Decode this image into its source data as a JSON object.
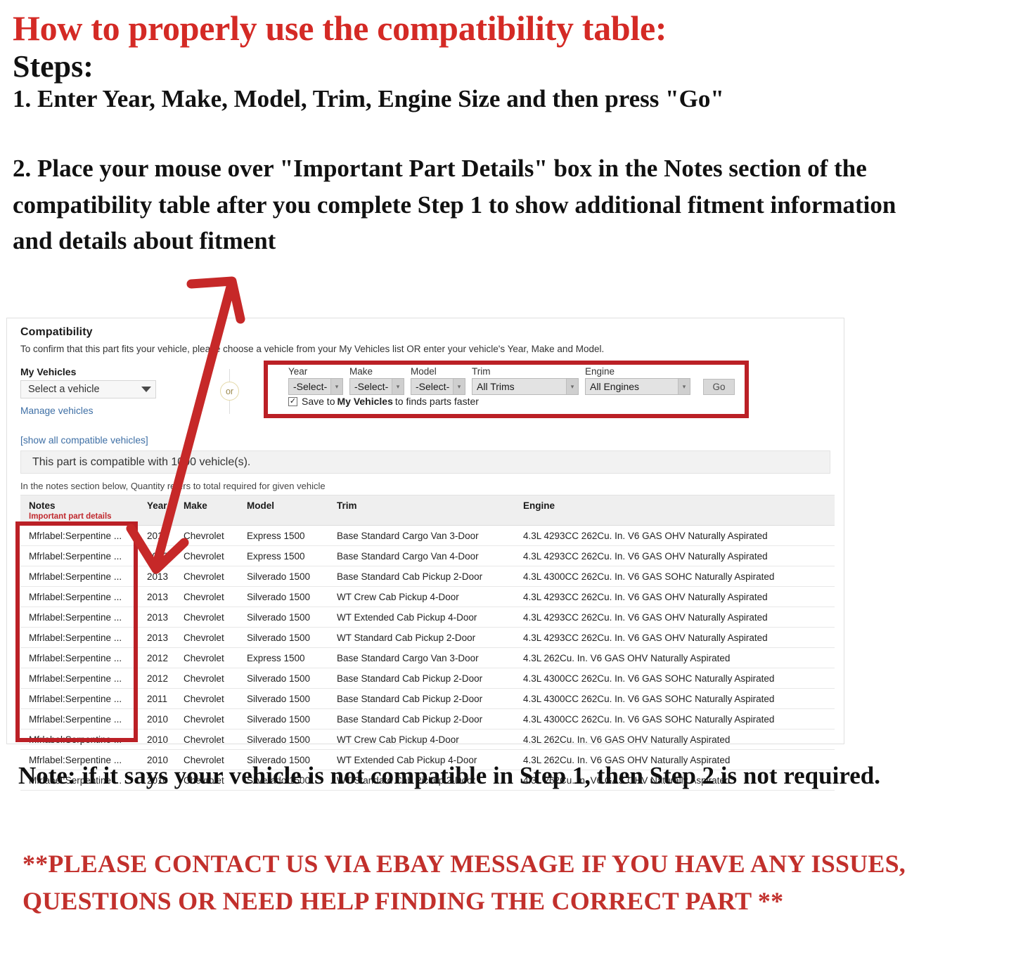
{
  "instructions": {
    "headline": "How to properly use the compatibility table:",
    "steps_label": "Steps:",
    "step_1": "1. Enter Year, Make, Model, Trim, Engine Size and then press \"Go\"",
    "step_2": "2. Place your mouse over \"Important Part Details\" box in the Notes section of the compatibility table after you complete Step 1 to show additional fitment information and details about fitment"
  },
  "compatibility": {
    "title": "Compatibility",
    "subtitle": "To confirm that this part fits your vehicle, please choose a vehicle from your My Vehicles list OR enter your vehicle's Year, Make and Model.",
    "my_vehicles_label": "My Vehicles",
    "vehicle_select_value": "Select a vehicle",
    "manage_vehicles_link": "Manage vehicles",
    "show_all_link": "[show all compatible vehicles]",
    "or_label": "or",
    "finder": {
      "year": {
        "label": "Year",
        "value": "-Select-"
      },
      "make": {
        "label": "Make",
        "value": "-Select-"
      },
      "model": {
        "label": "Model",
        "value": "-Select-"
      },
      "trim": {
        "label": "Trim",
        "value": "All Trims"
      },
      "engine": {
        "label": "Engine",
        "value": "All Engines"
      },
      "go_label": "Go"
    },
    "save_checkbox": {
      "checked_glyph": "✓",
      "text_before": "Save to ",
      "bold_text": "My Vehicles",
      "text_after": " to finds parts faster"
    },
    "banner": "This part is compatible with 1000 vehicle(s).",
    "quantity_note": "In the notes section below, Quantity refers to total required for given vehicle",
    "table": {
      "headers": {
        "notes": "Notes",
        "notes_sub": "Important part details",
        "year": "Year",
        "make": "Make",
        "model": "Model",
        "trim": "Trim",
        "engine": "Engine"
      },
      "rows": [
        {
          "notes": "Mfrlabel:Serpentine ...",
          "year": "2013",
          "make": "Chevrolet",
          "model": "Express 1500",
          "trim": "Base Standard Cargo Van 3-Door",
          "engine": "4.3L 4293CC 262Cu. In. V6 GAS OHV Naturally Aspirated"
        },
        {
          "notes": "Mfrlabel:Serpentine ...",
          "year": "2013",
          "make": "Chevrolet",
          "model": "Express 1500",
          "trim": "Base Standard Cargo Van 4-Door",
          "engine": "4.3L 4293CC 262Cu. In. V6 GAS OHV Naturally Aspirated"
        },
        {
          "notes": "Mfrlabel:Serpentine ...",
          "year": "2013",
          "make": "Chevrolet",
          "model": "Silverado 1500",
          "trim": "Base Standard Cab Pickup 2-Door",
          "engine": "4.3L 4300CC 262Cu. In. V6 GAS SOHC Naturally Aspirated"
        },
        {
          "notes": "Mfrlabel:Serpentine ...",
          "year": "2013",
          "make": "Chevrolet",
          "model": "Silverado 1500",
          "trim": "WT Crew Cab Pickup 4-Door",
          "engine": "4.3L 4293CC 262Cu. In. V6 GAS OHV Naturally Aspirated"
        },
        {
          "notes": "Mfrlabel:Serpentine ...",
          "year": "2013",
          "make": "Chevrolet",
          "model": "Silverado 1500",
          "trim": "WT Extended Cab Pickup 4-Door",
          "engine": "4.3L 4293CC 262Cu. In. V6 GAS OHV Naturally Aspirated"
        },
        {
          "notes": "Mfrlabel:Serpentine ...",
          "year": "2013",
          "make": "Chevrolet",
          "model": "Silverado 1500",
          "trim": "WT Standard Cab Pickup 2-Door",
          "engine": "4.3L 4293CC 262Cu. In. V6 GAS OHV Naturally Aspirated"
        },
        {
          "notes": "Mfrlabel:Serpentine ...",
          "year": "2012",
          "make": "Chevrolet",
          "model": "Express 1500",
          "trim": "Base Standard Cargo Van 3-Door",
          "engine": "4.3L 262Cu. In. V6 GAS OHV Naturally Aspirated"
        },
        {
          "notes": "Mfrlabel:Serpentine ...",
          "year": "2012",
          "make": "Chevrolet",
          "model": "Silverado 1500",
          "trim": "Base Standard Cab Pickup 2-Door",
          "engine": "4.3L 4300CC 262Cu. In. V6 GAS SOHC Naturally Aspirated"
        },
        {
          "notes": "Mfrlabel:Serpentine ...",
          "year": "2011",
          "make": "Chevrolet",
          "model": "Silverado 1500",
          "trim": "Base Standard Cab Pickup 2-Door",
          "engine": "4.3L 4300CC 262Cu. In. V6 GAS SOHC Naturally Aspirated"
        },
        {
          "notes": "Mfrlabel:Serpentine ...",
          "year": "2010",
          "make": "Chevrolet",
          "model": "Silverado 1500",
          "trim": "Base Standard Cab Pickup 2-Door",
          "engine": "4.3L 4300CC 262Cu. In. V6 GAS SOHC Naturally Aspirated"
        },
        {
          "notes": "Mfrlabel:Serpentine ...",
          "year": "2010",
          "make": "Chevrolet",
          "model": "Silverado 1500",
          "trim": "WT Crew Cab Pickup 4-Door",
          "engine": "4.3L 262Cu. In. V6 GAS OHV Naturally Aspirated"
        },
        {
          "notes": "Mfrlabel:Serpentine ...",
          "year": "2010",
          "make": "Chevrolet",
          "model": "Silverado 1500",
          "trim": "WT Extended Cab Pickup 4-Door",
          "engine": "4.3L 262Cu. In. V6 GAS OHV Naturally Aspirated"
        },
        {
          "notes": "Mfrlabel:Serpentine ...",
          "year": "2010",
          "make": "Chevrolet",
          "model": "Silverado 1500",
          "trim": "WT Standard Cab Pickup 2-Door",
          "engine": "4.3L 262Cu. In. V6 GAS OHV Naturally Aspirated"
        }
      ]
    }
  },
  "footer": {
    "note": "Note: if it says your vehicle is not compatible in Step 1, then Step 2 is not required.",
    "contact": "**PLEASE CONTACT US VIA EBAY MESSAGE IF YOU HAVE ANY ISSUES, QUESTIONS OR NEED HELP FINDING THE CORRECT PART **"
  },
  "colors": {
    "headline_red": "#d42a25",
    "highlight_red": "#bb2026",
    "link_blue": "#3e6fa5",
    "notes_sub_red": "#c0292e",
    "contact_red": "#c2302c"
  }
}
